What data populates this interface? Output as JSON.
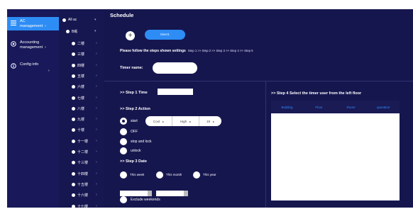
{
  "nav": {
    "items": [
      {
        "label": "AC\nmanagement",
        "chevron": "›",
        "icon": "list-icon",
        "active": true
      },
      {
        "label": "Accounting\nmanagement",
        "chevron": "›",
        "icon": "target-icon",
        "active": false
      },
      {
        "label": "Config info",
        "chevron": "›",
        "icon": "info-icon",
        "active": false
      }
    ]
  },
  "tree": {
    "root": "All ac",
    "building": "B栋",
    "floors": [
      "二楼",
      "三楼",
      "四楼",
      "五楼",
      "六楼",
      "七楼",
      "八楼",
      "九楼",
      "十楼",
      "十一楼",
      "十二楼",
      "十三楼",
      "十四楼",
      "十五楼",
      "十六楼",
      "十七楼"
    ]
  },
  "schedule": {
    "title": "Schedule",
    "add_icon": "+",
    "timer_tab": "timer1",
    "instruction": "Please follow the steps shown settings",
    "steps_hint": "Step 1 >> Step 2 >> Step 3 >> Step 4 >> Step 5",
    "timer_name_label": "Timer name:",
    "timer_name_value": "",
    "step1": ">>  Step 1 Time",
    "step2": ">>  Step 2 Action",
    "step3": ">>  Step 3 Date",
    "actions": [
      "start",
      "OFF",
      "stop and lock",
      "unlock"
    ],
    "mode": "Cool",
    "fan": "High",
    "temp": "19",
    "dates": [
      "This week",
      "This month",
      "This year"
    ],
    "exclude": "Exclude weekends",
    "step4": ">>  Step 4 Select the timer user from the left floor",
    "table_headers": [
      "Building",
      "Floor",
      "Room",
      "operation"
    ]
  }
}
